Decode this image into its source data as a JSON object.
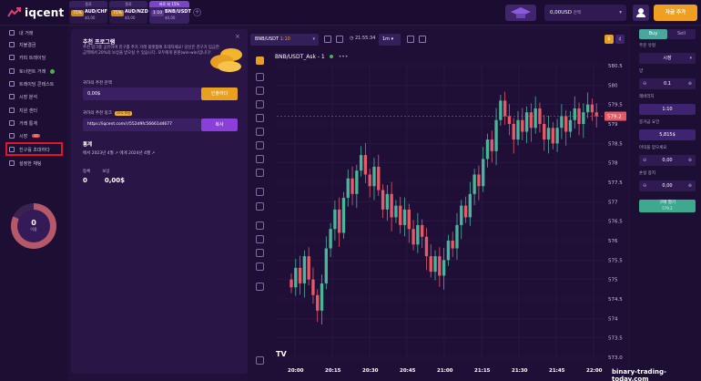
{
  "brand": {
    "name": "iqcent"
  },
  "tabs": [
    {
      "head": "종료",
      "pct": "75%",
      "pair": "AUD/CHF",
      "amt": "$0,00"
    },
    {
      "head": "종료",
      "pct": "75%",
      "pair": "AUD/NZD",
      "amt": "$0,00"
    },
    {
      "head": "바로 외 15%",
      "pct": "1:10",
      "pair": "BNB/USDT",
      "amt": "$0,00"
    }
  ],
  "header": {
    "balance": "0,00USD",
    "balance_sub": "잔액",
    "deposit": "자금 추가"
  },
  "sidebar": {
    "items": [
      {
        "label": "내 거래"
      },
      {
        "label": "지불결금"
      },
      {
        "label": "카피 트레이딩"
      },
      {
        "label": "토너먼트 거래"
      },
      {
        "label": "트레이딩 콘테스트"
      },
      {
        "label": "시장 분석"
      },
      {
        "label": "지원 센터"
      },
      {
        "label": "거래 통계"
      },
      {
        "label": "시장",
        "badge": "12"
      },
      {
        "label": "친구를 초대하다"
      },
      {
        "label": "설정한 채팅"
      }
    ],
    "level": {
      "value": "0",
      "label": "이용"
    }
  },
  "referral": {
    "title": "추천 프로그램",
    "description": "추천 링크를 공유하여 친구를 추가 거래 플랫폼에 초대하세요! 당신은 친구가 입금한 금액에서 20%의 보상을 받으실 수 있습니다. 모두에게 윈윈(win-win)입니다!",
    "balance_label": "귀하의 추천 잔액",
    "balance_value": "0,00$",
    "withdraw_btn": "인출하다",
    "link_label": "귀하의 추천 링크",
    "link_badge": "20% 보상",
    "link_value": "https://iqcent.com/r/552d9fc56661d4677",
    "copy_btn": "복사",
    "stats_title": "통계",
    "stats_period": "에서 2023년 4월 ↗   에게 2024년 4월 ↗",
    "registered_label": "등록",
    "reward_label": "보상",
    "registered_value": "0",
    "reward_value": "0,00$"
  },
  "chart_toolbar": {
    "symbol": "BNB/USDT",
    "leverage": "1:10",
    "time": "21:55:34",
    "timeframe": "1m",
    "currency_usd": "$",
    "currency_coin": "¢"
  },
  "chart": {
    "title": "BNB/USDT_Ask - 1",
    "price_tag": "579.2",
    "watermark": "TV"
  },
  "chart_data": {
    "type": "candlestick",
    "title": "BNB/USDT_Ask - 1",
    "y_ticks": [
      "580.5",
      "580",
      "579.5",
      "579",
      "578.5",
      "578",
      "577.5",
      "577",
      "576.5",
      "576",
      "575.5",
      "575",
      "574.5",
      "574",
      "573.5",
      "573.0"
    ],
    "ylim": [
      573.0,
      580.5
    ],
    "x_ticks": [
      "20:00",
      "20:15",
      "20:30",
      "20:45",
      "21:00",
      "21:15",
      "21:30",
      "21:45",
      "22:00"
    ],
    "last_price": 579.2,
    "close_series": [
      574.8,
      575.3,
      574.9,
      575.6,
      575.0,
      574.6,
      574.2,
      574.9,
      575.8,
      576.3,
      576.8,
      576.2,
      577.1,
      577.6,
      577.2,
      577.8,
      578.2,
      577.7,
      577.4,
      577.9,
      577.3,
      576.8,
      577.2,
      576.6,
      576.9,
      576.4,
      576.8,
      576.3,
      575.9,
      576.4,
      576.1,
      575.6,
      575.2,
      575.6,
      575.1,
      575.5,
      576.0,
      575.8,
      576.4,
      576.9,
      576.6,
      577.2,
      577.7,
      577.4,
      578.1,
      578.6,
      578.3,
      579.1,
      579.6,
      579.2,
      579.0,
      578.6,
      579.1,
      578.8,
      579.3,
      578.9,
      579.4,
      579.0,
      578.6,
      578.9,
      578.5,
      578.9,
      579.2,
      578.8,
      579.1,
      579.4,
      579.0,
      579.3,
      579.5,
      579.3,
      579.2
    ]
  },
  "trade": {
    "buy_tab": "Buy",
    "sell_tab": "Sell",
    "order_type_label": "주문 유형",
    "order_type": "시장",
    "amount_label": "양",
    "amount": "0.1",
    "leverage_label": "레버리지",
    "leverage": "1:10",
    "margin_label": "증거금 요건",
    "margin": "5,815$",
    "take_profit_label": "이익을 얻으세요",
    "take_profit": "0,00",
    "stop_loss_label": "손실 중지",
    "stop_loss": "0,00",
    "buy_btn": "구매 열기",
    "buy_sub": "579.2"
  },
  "site": {
    "watermark": "binary-trading-today.com"
  }
}
